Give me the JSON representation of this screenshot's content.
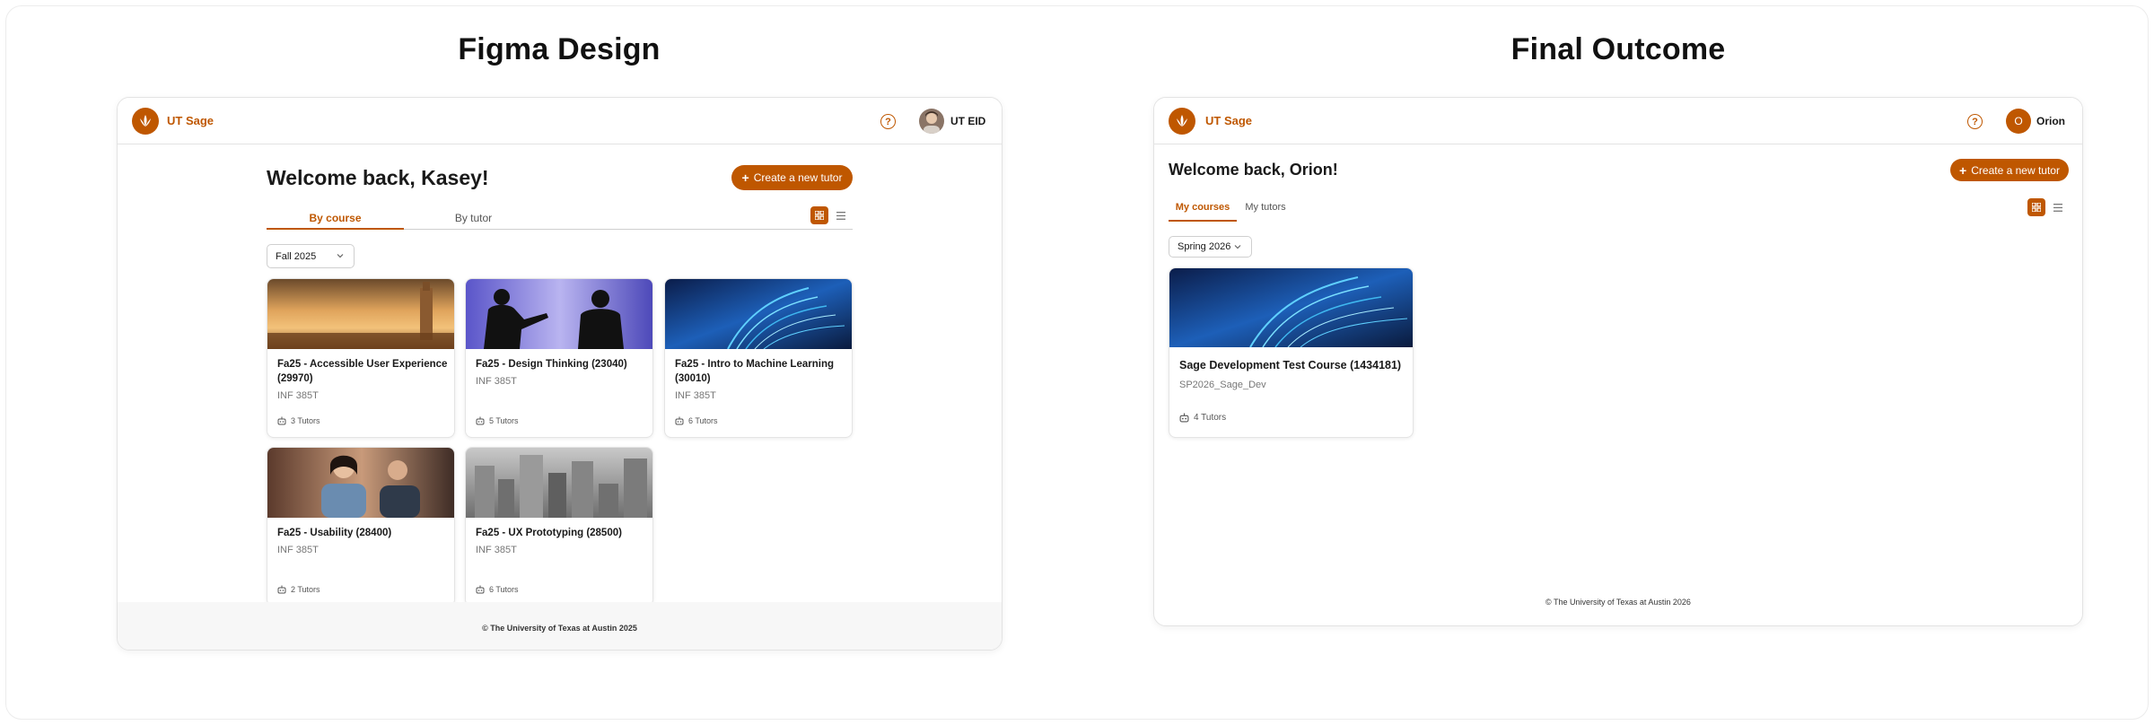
{
  "titles": {
    "left": "Figma Design",
    "right": "Final Outcome"
  },
  "colors": {
    "accent": "#bf5700",
    "text": "#1a1a1a",
    "muted": "#777777"
  },
  "figma": {
    "logo_text": "UT Sage",
    "user": "UT EID",
    "welcome": "Welcome back, Kasey!",
    "create_label": "Create a new tutor",
    "tabs": [
      "By course",
      "By tutor"
    ],
    "semester": "Fall 2025",
    "cards": [
      {
        "title": "Fa25 - Accessible User Experience (29970)",
        "sub": "INF 385T",
        "tutors": "3 Tutors",
        "image": "tower-sunset"
      },
      {
        "title": "Fa25 - Design Thinking (23040)",
        "sub": "INF 385T",
        "tutors": "5 Tutors",
        "image": "silhouettes-board"
      },
      {
        "title": "Fa25 - Intro to Machine Learning (30010)",
        "sub": "INF 385T",
        "tutors": "6 Tutors",
        "image": "server-lights"
      },
      {
        "title": "Fa25 - Usability (28400)",
        "sub": "INF 385T",
        "tutors": "2 Tutors",
        "image": "people-phone"
      },
      {
        "title": "Fa25 - UX Prototyping (28500)",
        "sub": "INF 385T",
        "tutors": "6 Tutors",
        "image": "city-skyline"
      }
    ],
    "footer": "© The University of Texas at Austin 2025"
  },
  "final": {
    "logo_text": "UT Sage",
    "avatar_initial": "O",
    "user": "Orion",
    "welcome": "Welcome back, Orion!",
    "create_label": "Create a new tutor",
    "tabs": [
      "My courses",
      "My tutors"
    ],
    "semester": "Spring 2026",
    "cards": [
      {
        "title": "Sage Development Test Course (1434181)",
        "sub": "SP2026_Sage_Dev",
        "tutors": "4 Tutors",
        "image": "server-lights"
      }
    ],
    "footer": "© The University of Texas at Austin 2026"
  },
  "icons": {
    "logo": "longhorn-leaf-icon",
    "help": "help-circle-icon",
    "grid_view": "grid-view-icon",
    "list_view": "list-view-icon",
    "chevron": "chevron-down-icon",
    "tutor": "robot-icon",
    "plus": "plus-icon"
  }
}
